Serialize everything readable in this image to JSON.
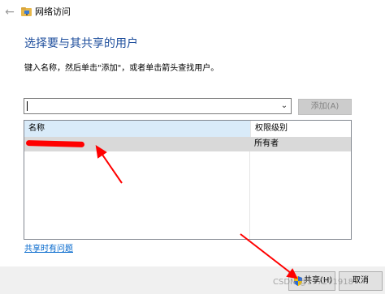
{
  "window": {
    "title": "网络访问",
    "back_icon": "back-arrow-icon"
  },
  "main": {
    "heading": "选择要与其共享的用户",
    "instruction": "键入名称，然后单击\"添加\"，或者单击箭头查找用户。",
    "name_input_value": "",
    "add_button": "添加(A)"
  },
  "table": {
    "headers": [
      "名称",
      "权限级别"
    ],
    "rows": [
      {
        "name": "",
        "permission": "所有者"
      }
    ]
  },
  "help_link": "共享时有问题",
  "footer": {
    "share_button": "共享(H)",
    "cancel_button": "取消",
    "watermark": "CSDN @177271918"
  },
  "colors": {
    "heading": "#1e4e9c",
    "link": "#0066cc",
    "selected_row": "#d9d9d9",
    "header_highlight": "#d9ebf9",
    "annotation": "#ff0000"
  }
}
